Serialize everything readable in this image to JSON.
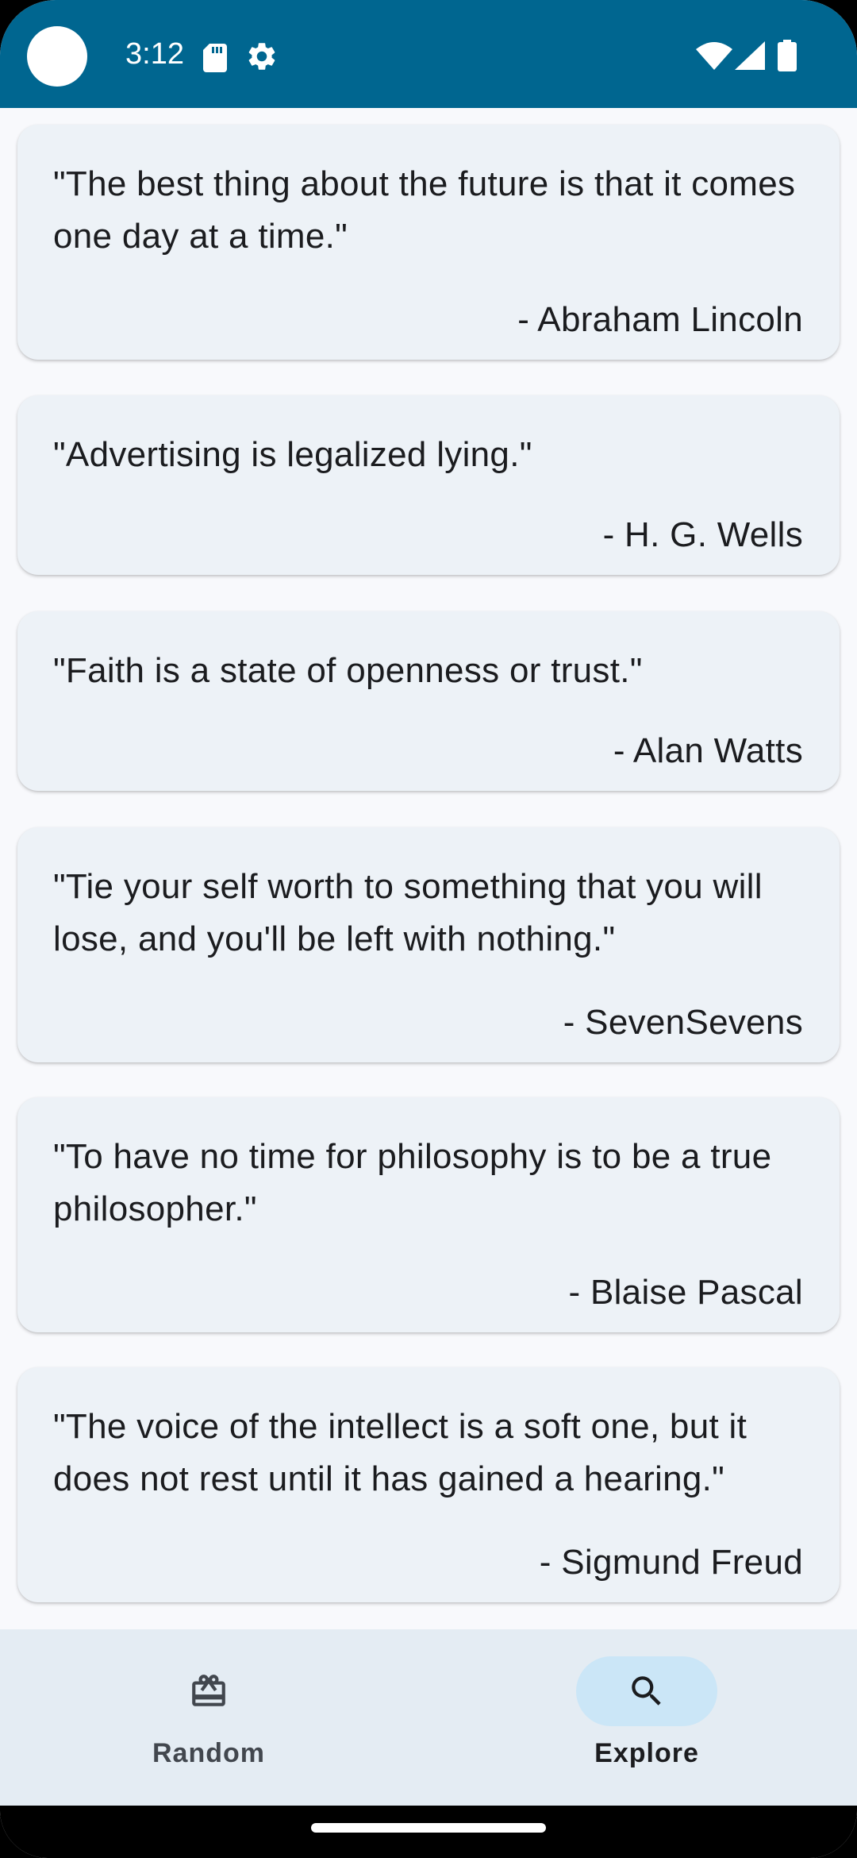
{
  "status_bar": {
    "time": "3:12",
    "icons": [
      "sd-card-icon",
      "gear-icon",
      "wifi-icon",
      "signal-icon",
      "battery-icon"
    ],
    "background_color": "#006690"
  },
  "quotes": [
    {
      "text": "\"The best thing about the future is that it comes one day at a time.\"",
      "author": "- Abraham Lincoln"
    },
    {
      "text": "\"Advertising is legalized lying.\"",
      "author": "- H. G. Wells"
    },
    {
      "text": "\"Faith is a state of openness or trust.\"",
      "author": "- Alan Watts"
    },
    {
      "text": "\"Tie your self worth to something that you will lose, and you'll be left with nothing.\"",
      "author": "- SevenSevens"
    },
    {
      "text": "\"To have no time for philosophy is to be a true philosopher.\"",
      "author": "- Blaise Pascal"
    },
    {
      "text": "\"The voice of the intellect is a soft one, but it does not rest until it has gained a hearing.\"",
      "author": "- Sigmund Freud"
    }
  ],
  "bottom_nav": {
    "items": [
      {
        "label": "Random",
        "icon": "gift-icon",
        "selected": false
      },
      {
        "label": "Explore",
        "icon": "search-icon",
        "selected": true
      }
    ],
    "selected_indicator_color": "#cbe6f7"
  }
}
